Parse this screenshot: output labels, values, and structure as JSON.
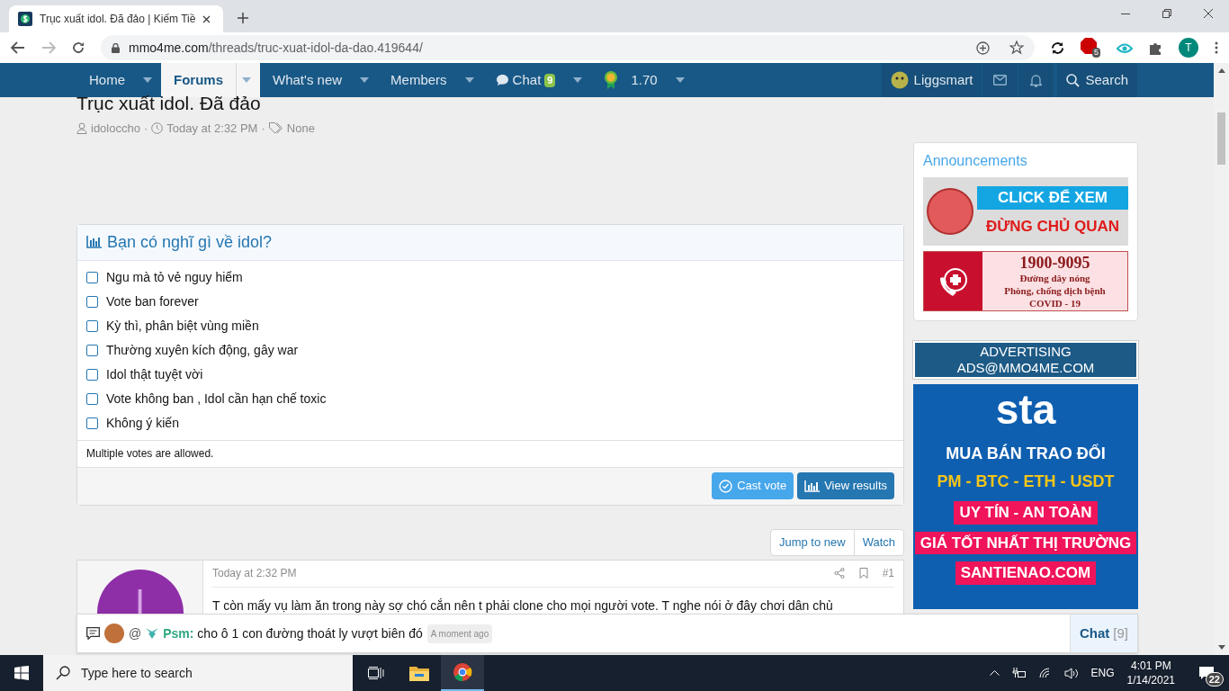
{
  "browser": {
    "tab_title": "Trục xuất idol. Đã đảo | Kiếm Tiề",
    "url_host": "mmo4me.com",
    "url_path": "/threads/truc-xuat-idol-da-dao.419644/",
    "abp_count": "5",
    "profile_letter": "T"
  },
  "nav": {
    "items": [
      {
        "label": "Home",
        "selected": false,
        "kind": "plain"
      },
      {
        "label": "Forums",
        "selected": true,
        "kind": "plain"
      },
      {
        "label": "What's new",
        "selected": false,
        "kind": "plain"
      },
      {
        "label": "Members",
        "selected": false,
        "kind": "plain"
      },
      {
        "label": "Chat",
        "selected": false,
        "kind": "chat",
        "badge": "9"
      },
      {
        "label": "1.70",
        "selected": false,
        "kind": "medal"
      }
    ],
    "user": "Liggsmart",
    "search": "Search"
  },
  "thread": {
    "title": "Trục xuất idol. Đã đảo",
    "author": "idoloccho",
    "time": "Today at 2:32 PM",
    "tags": "None",
    "separator": "·"
  },
  "poll": {
    "title": "Bạn có nghĩ gì về idol?",
    "options": [
      {
        "label": "Ngu mà tỏ vẻ nguy hiểm",
        "checked": false
      },
      {
        "label": "Vote ban forever",
        "checked": false
      },
      {
        "label": "Kỳ thì, phân biệt vùng miền",
        "checked": false
      },
      {
        "label": "Thường xuyên kích động, gây war",
        "checked": false
      },
      {
        "label": "Idol thật tuyệt vời",
        "checked": false
      },
      {
        "label": "Vote không ban , Idol cần hạn chế toxic",
        "checked": false
      },
      {
        "label": "Không ý kiến",
        "checked": false
      }
    ],
    "note": "Multiple votes are allowed.",
    "cast": "Cast vote",
    "results": "View results"
  },
  "thread_actions": [
    "Jump to new",
    "Watch"
  ],
  "post": {
    "avatar_letter": "I",
    "time": "Today at 2:32 PM",
    "number": "#1",
    "body": "T còn mấy vụ làm ăn trong này sợ chó cắn nên t phải clone cho mọi người vote. T nghe nói ở đây chơi dân chủ"
  },
  "sidebar": {
    "announcements": "Announcements",
    "banner_click": [
      "CLICK ĐỂ XEM",
      "ĐỪNG CHỦ QUAN"
    ],
    "banner_hotline": [
      "1900-9095",
      "Đường dây nóng",
      "Phòng, chống dịch bệnh",
      "COVID - 19"
    ],
    "advertising": [
      "ADVERTISING",
      "ADS@MMO4ME.COM"
    ],
    "sta_ad": {
      "logo": "sta",
      "line1": "MUA BÁN TRAO ĐỔI",
      "line2": "PM - BTC - ETH - USDT",
      "ribbons": [
        "UY TÍN - AN TOÀN",
        "GIÁ TỐT NHẤT THỊ TRƯỜNG",
        "SANTIENAO.COM"
      ]
    }
  },
  "chat_bar": {
    "mention": "@",
    "user": "Psm:",
    "message": "cho ô 1 con đường thoát ly vượt biên đó",
    "time": "A moment ago",
    "label": "Chat",
    "count": "[9]"
  },
  "taskbar": {
    "search_placeholder": "Type here to search",
    "lang": "ENG",
    "time": "4:01 PM",
    "date": "1/14/2021",
    "notifications": "22"
  }
}
